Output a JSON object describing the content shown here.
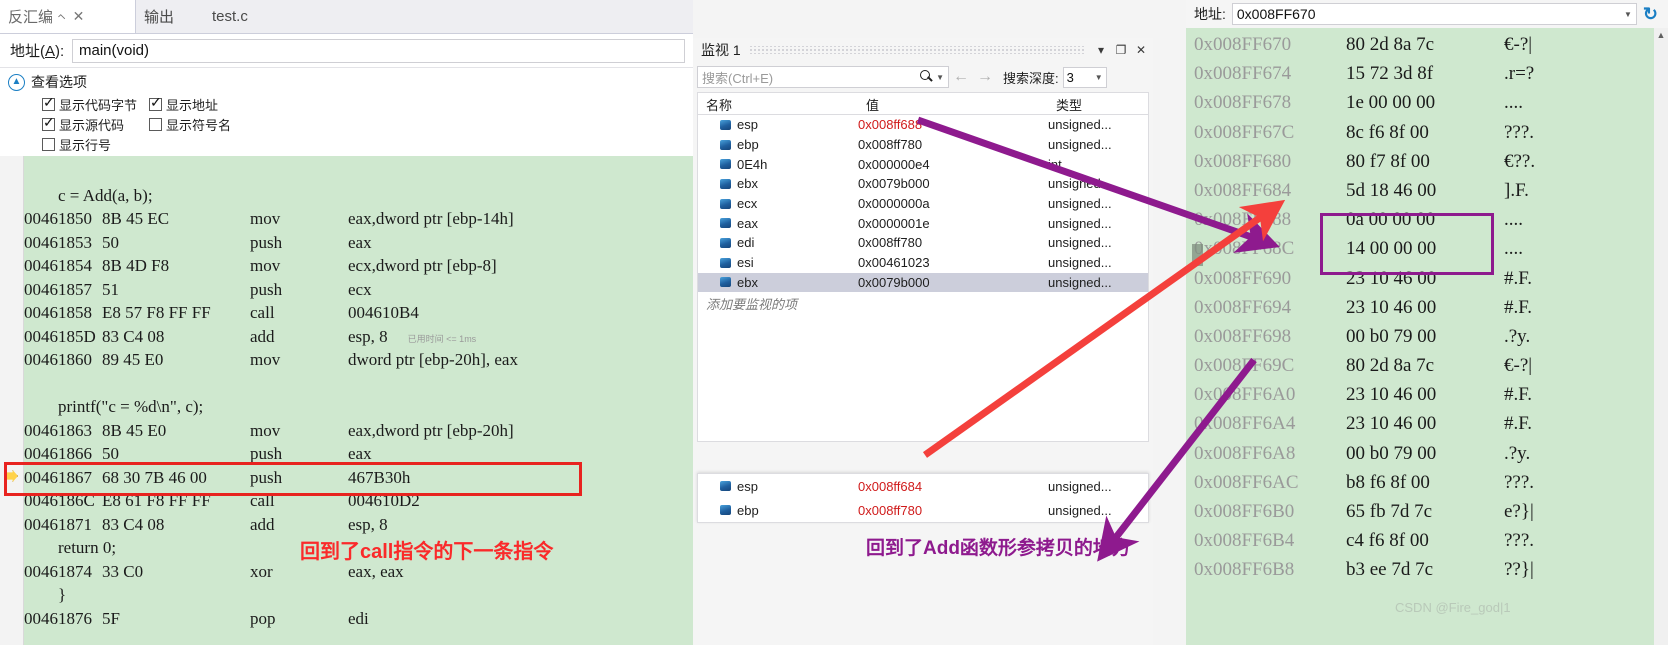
{
  "disassembly": {
    "tabs": [
      {
        "label": "反汇编",
        "active": true,
        "pin": "⌐",
        "close": "✕"
      },
      {
        "label": "输出",
        "active": false
      },
      {
        "label": "test.c",
        "active": false
      }
    ],
    "address_bar": {
      "label_prefix": "地址(",
      "label_key": "A",
      "label_suffix": "):",
      "value": "main(void)"
    },
    "view_options": {
      "header": "查看选项",
      "checkboxes": [
        {
          "label": "显示代码字节",
          "checked": true
        },
        {
          "label": "显示地址",
          "checked": true
        },
        {
          "label": "显示源代码",
          "checked": true
        },
        {
          "label": "显示符号名",
          "checked": false
        },
        {
          "label": "显示行号",
          "checked": false
        }
      ]
    },
    "lines": [
      {
        "kind": "blank"
      },
      {
        "kind": "src",
        "text": "c = Add(a, b);"
      },
      {
        "kind": "asm",
        "addr": "00461850",
        "bytes": "8B 45 EC",
        "mnemonic": "mov",
        "operands": "eax,dword ptr [ebp-14h]"
      },
      {
        "kind": "asm",
        "addr": "00461853",
        "bytes": "50",
        "mnemonic": "push",
        "operands": "eax"
      },
      {
        "kind": "asm",
        "addr": "00461854",
        "bytes": "8B 4D F8",
        "mnemonic": "mov",
        "operands": "ecx,dword ptr [ebp-8]"
      },
      {
        "kind": "asm",
        "addr": "00461857",
        "bytes": "51",
        "mnemonic": "push",
        "operands": "ecx"
      },
      {
        "kind": "asm",
        "addr": "00461858",
        "bytes": "E8 57 F8 FF FF",
        "mnemonic": "call",
        "operands": "004610B4"
      },
      {
        "kind": "asm",
        "addr": "0046185D",
        "bytes": "83 C4 08",
        "mnemonic": "add",
        "operands": "esp, 8",
        "timing": "已用时间 <= 1ms",
        "current": true
      },
      {
        "kind": "asm",
        "addr": "00461860",
        "bytes": "89 45 E0",
        "mnemonic": "mov",
        "operands": "dword ptr [ebp-20h], eax"
      },
      {
        "kind": "blank"
      },
      {
        "kind": "src",
        "text": "printf(\"c = %d\\n\", c);"
      },
      {
        "kind": "asm",
        "addr": "00461863",
        "bytes": "8B 45 E0",
        "mnemonic": "mov",
        "operands": "eax,dword ptr [ebp-20h]"
      },
      {
        "kind": "asm",
        "addr": "00461866",
        "bytes": "50",
        "mnemonic": "push",
        "operands": "eax"
      },
      {
        "kind": "asm",
        "addr": "00461867",
        "bytes": "68 30 7B 46 00",
        "mnemonic": "push",
        "operands": "467B30h"
      },
      {
        "kind": "asm",
        "addr": "0046186C",
        "bytes": "E8 61 F8 FF FF",
        "mnemonic": "call",
        "operands": "004610D2"
      },
      {
        "kind": "asm",
        "addr": "00461871",
        "bytes": "83 C4 08",
        "mnemonic": "add",
        "operands": "esp, 8"
      },
      {
        "kind": "src",
        "text": "return 0;"
      },
      {
        "kind": "asm",
        "addr": "00461874",
        "bytes": "33 C0",
        "mnemonic": "xor",
        "operands": "eax, eax"
      },
      {
        "kind": "src",
        "text": "}"
      },
      {
        "kind": "asm",
        "addr": "00461876",
        "bytes": "5F",
        "mnemonic": "pop",
        "operands": "edi"
      }
    ]
  },
  "watch": {
    "title": "监视 1",
    "window_buttons": {
      "minimize": "▾",
      "maximize": "❐",
      "close": "✕"
    },
    "search_placeholder": "搜索(Ctrl+E)",
    "nav_back": "←",
    "nav_forward": "→",
    "depth_label": "搜索深度:",
    "depth_value": "3",
    "columns": [
      "名称",
      "值",
      "类型"
    ],
    "rows": [
      {
        "name": "esp",
        "value": "0x008ff688",
        "type": "unsigned...",
        "value_red": true,
        "selected": false
      },
      {
        "name": "ebp",
        "value": "0x008ff780",
        "type": "unsigned...",
        "value_red": false,
        "selected": false
      },
      {
        "name": "0E4h",
        "value": "0x000000e4",
        "type": "int",
        "value_red": false,
        "selected": false
      },
      {
        "name": "ebx",
        "value": "0x0079b000",
        "type": "unsigned...",
        "value_red": false,
        "selected": false
      },
      {
        "name": "ecx",
        "value": "0x0000000a",
        "type": "unsigned...",
        "value_red": false,
        "selected": false
      },
      {
        "name": "eax",
        "value": "0x0000001e",
        "type": "unsigned...",
        "value_red": false,
        "selected": false
      },
      {
        "name": "edi",
        "value": "0x008ff780",
        "type": "unsigned...",
        "value_red": false,
        "selected": false
      },
      {
        "name": "esi",
        "value": "0x00461023",
        "type": "unsigned...",
        "value_red": false,
        "selected": false
      },
      {
        "name": "ebx",
        "value": "0x0079b000",
        "type": "unsigned...",
        "value_red": false,
        "selected": true
      }
    ],
    "add_row_placeholder": "添加要监视的项",
    "overlay_rows": [
      {
        "name": "esp",
        "value": "0x008ff684",
        "type": "unsigned...",
        "value_red": true
      },
      {
        "name": "ebp",
        "value": "0x008ff780",
        "type": "unsigned...",
        "value_red": true
      }
    ]
  },
  "memory": {
    "address_label": "地址:",
    "address_value": "0x008FF670",
    "refresh_icon": "↻",
    "scroll_up_icon": "▲",
    "rows": [
      {
        "address": "0x008FF670",
        "hex": "80 2d 8a 7c",
        "ascii": "€-?|"
      },
      {
        "address": "0x008FF674",
        "hex": "15 72 3d 8f",
        "ascii": ".r=?"
      },
      {
        "address": "0x008FF678",
        "hex": "1e 00 00 00",
        "ascii": "...."
      },
      {
        "address": "0x008FF67C",
        "hex": "8c f6 8f 00",
        "ascii": "???."
      },
      {
        "address": "0x008FF680",
        "hex": "80 f7 8f 00",
        "ascii": "€??."
      },
      {
        "address": "0x008FF684",
        "hex": "5d 18 46 00",
        "ascii": "].F."
      },
      {
        "address": "0x008FF688",
        "hex": "0a 00 00 00",
        "ascii": "....",
        "highlighted": true
      },
      {
        "address": "0x008FF68C",
        "hex": "14 00 00 00",
        "ascii": "....",
        "highlighted": true
      },
      {
        "address": "0x008FF690",
        "hex": "23 10 46 00",
        "ascii": "#.F."
      },
      {
        "address": "0x008FF694",
        "hex": "23 10 46 00",
        "ascii": "#.F."
      },
      {
        "address": "0x008FF698",
        "hex": "00 b0 79 00",
        "ascii": ".?y."
      },
      {
        "address": "0x008FF69C",
        "hex": "80 2d 8a 7c",
        "ascii": "€-?|"
      },
      {
        "address": "0x008FF6A0",
        "hex": "23 10 46 00",
        "ascii": "#.F."
      },
      {
        "address": "0x008FF6A4",
        "hex": "23 10 46 00",
        "ascii": "#.F."
      },
      {
        "address": "0x008FF6A8",
        "hex": "00 b0 79 00",
        "ascii": ".?y."
      },
      {
        "address": "0x008FF6AC",
        "hex": "b8 f6 8f 00",
        "ascii": "???."
      },
      {
        "address": "0x008FF6B0",
        "hex": "65 fb 7d 7c",
        "ascii": "e?}|"
      },
      {
        "address": "0x008FF6B4",
        "hex": "c4 f6 8f 00",
        "ascii": "???."
      },
      {
        "address": "0x008FF6B8",
        "hex": "b3 ee 7d 7c",
        "ascii": "??}|"
      }
    ]
  },
  "annotations": {
    "red_text": "回到了call指令的下一条指令",
    "purple_text": "回到了Add函数形参拷贝的地方",
    "watermark": "CSDN @Fire_god|1"
  },
  "colors": {
    "accent_blue": "#1b7fc4",
    "code_bg": "#cfe8cf",
    "annot_red": "#fa2a2a",
    "annot_purple": "#8e1a8e",
    "value_red": "#d01b1b"
  }
}
